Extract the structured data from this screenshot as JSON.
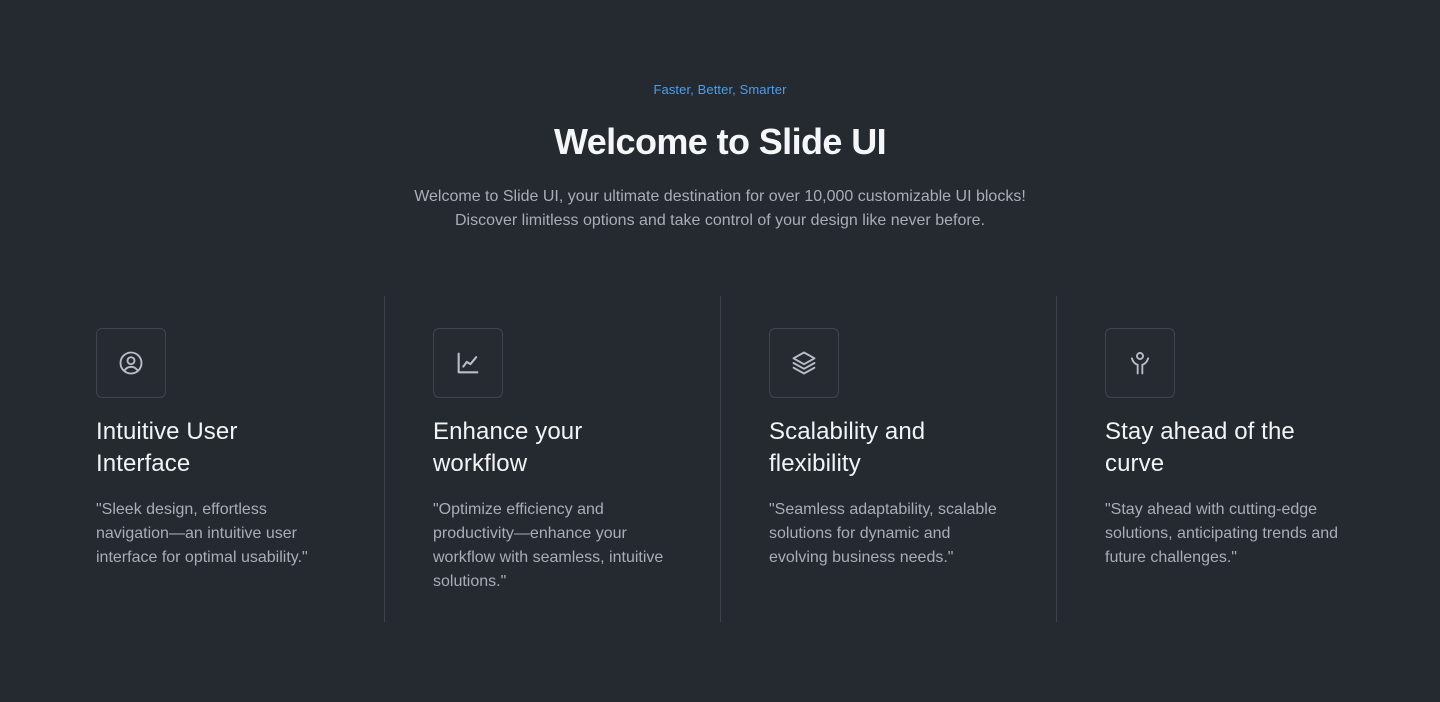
{
  "hero": {
    "eyebrow": "Faster, Better, Smarter",
    "title": "Welcome to Slide UI",
    "subtitle": "Welcome to Slide UI, your ultimate destination for over 10,000 customizable UI blocks! Discover limitless options and take control of your design like never before."
  },
  "features": [
    {
      "icon": "user-circle-icon",
      "title": "Intuitive User Interface",
      "description": "\"Sleek design, effortless navigation—an intuitive user interface for optimal usability.\""
    },
    {
      "icon": "chart-line-icon",
      "title": "Enhance your workflow",
      "description": "\"Optimize efficiency and productivity—enhance your workflow with seamless, intuitive solutions.\""
    },
    {
      "icon": "layers-icon",
      "title": "Scalability and flexibility",
      "description": "\"Seamless adaptability, scalable solutions for dynamic and evolving business needs.\""
    },
    {
      "icon": "person-arms-up-icon",
      "title": "Stay ahead of the curve",
      "description": "\"Stay ahead with cutting-edge solutions, anticipating trends and future challenges.\""
    }
  ],
  "colors": {
    "background": "#252a31",
    "accent": "#4b9fea",
    "text_primary": "#f2f3f5",
    "text_muted": "#a9aeb6",
    "divider": "#3d434c"
  }
}
